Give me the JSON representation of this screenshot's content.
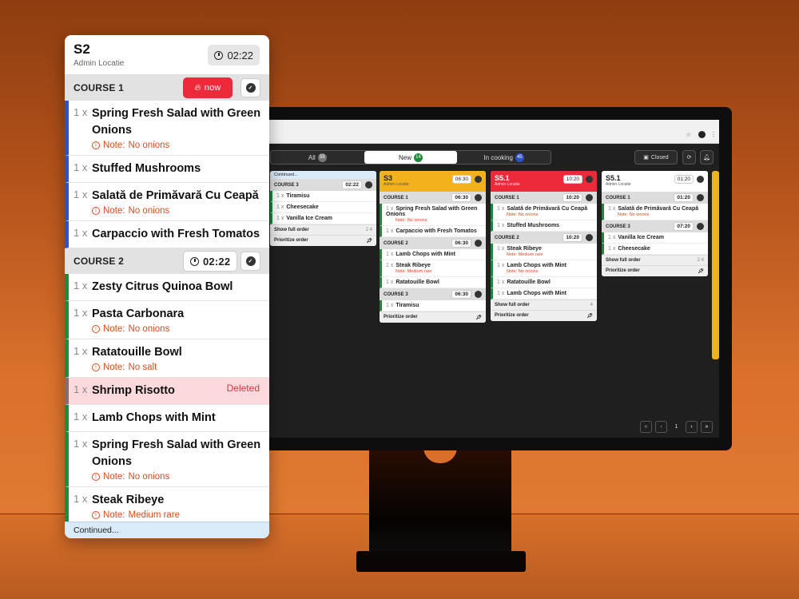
{
  "background_colors": {
    "accent_red": "#ec2a3a",
    "green": "#1d8b3b",
    "blue": "#2d53c8",
    "note_orange": "#e2481b"
  },
  "order": {
    "table": "S2",
    "location": "Admin Locatie",
    "timer": "02:22",
    "courses": [
      {
        "label": "COURSE 1",
        "action": "now",
        "items": [
          {
            "qty": "1 x",
            "name": "Spring Fresh Salad with Green Onions",
            "note_label": "Note:",
            "note": "No onions"
          },
          {
            "qty": "1 x",
            "name": "Stuffed Mushrooms"
          },
          {
            "qty": "1 x",
            "name": "Salată de Primăvară Cu Ceapă",
            "note_label": "Note:",
            "note": "No onions"
          },
          {
            "qty": "1 x",
            "name": "Carpaccio with Fresh Tomatos"
          }
        ]
      },
      {
        "label": "COURSE 2",
        "timer": "02:22",
        "items": [
          {
            "qty": "1 x",
            "name": "Zesty Citrus Quinoa Bowl"
          },
          {
            "qty": "1 x",
            "name": "Pasta Carbonara",
            "note_label": "Note:",
            "note": "No onions"
          },
          {
            "qty": "1 x",
            "name": "Ratatouille Bowl",
            "note_label": "Note:",
            "note": "No salt"
          },
          {
            "qty": "1 x",
            "name": "Shrimp Risotto",
            "status": "Deleted"
          },
          {
            "qty": "1 x",
            "name": "Lamb Chops with Mint"
          },
          {
            "qty": "1 x",
            "name": "Spring Fresh Salad with Green Onions",
            "note_label": "Note:",
            "note": "No onions"
          },
          {
            "qty": "1 x",
            "name": "Steak Ribeye",
            "note_label": "Note:",
            "note": "Medium rare"
          }
        ]
      }
    ],
    "continued": "Continued..."
  },
  "monitor": {
    "filters": [
      {
        "label": "All",
        "count": "59"
      },
      {
        "label": "New",
        "count": "14"
      },
      {
        "label": "In cooking",
        "count": "45"
      }
    ],
    "closed_label": "Closed",
    "cards": [
      {
        "header": "Continued...",
        "course": "COURSE 3",
        "time": "02:22",
        "items": [
          "Tiramisu",
          "Cheesecake",
          "Vanilla Ice Cream"
        ],
        "foot": "Show full order",
        "foot_counts": "2   4",
        "prio": "Prioritize order"
      },
      {
        "title": "S3",
        "sub": "Admin Locatie",
        "time": "06:30",
        "course1": "COURSE 1",
        "c1time": "06:30",
        "items1": [
          "Spring Fresh Salad with Green Onions",
          "Carpaccio with Fresh Tomatos"
        ],
        "note1": "No onions",
        "course2": "COURSE 2",
        "c2time": "06:30",
        "items2": [
          "Lamb Chops with Mint",
          "Steak Ribeye",
          "Ratatouille Bowl"
        ],
        "note2": "Medium rare",
        "course3": "COURSE 3",
        "c3time": "06:30",
        "items3": [
          "Tiramisu"
        ],
        "prio": "Prioritize order"
      },
      {
        "title": "S5.1",
        "sub": "Admin Locatie",
        "time": "10:20",
        "course1": "COURSE 1",
        "c1time": "10:20",
        "items1": [
          "Salată de Primăvară Cu Ceapă",
          "Stuffed Mushrooms"
        ],
        "note1": "No onions",
        "course2": "COURSE 2",
        "c2time": "10:20",
        "items2": [
          "Steak Ribeye",
          "Lamb Chops with Mint",
          "Ratatouille Bowl",
          "Lamb Chops with Mint"
        ],
        "note2a": "Medium rare",
        "note2b": "No onions",
        "foot": "Show full order",
        "foot_counts": "4",
        "prio": "Prioritize order"
      },
      {
        "title": "S5.1",
        "sub": "Admin Locatie",
        "time": "01:20",
        "course1": "COURSE 1",
        "c1time": "01:20",
        "items1": [
          "Salată de Primăvară Cu Ceapă"
        ],
        "note1": "No onions",
        "course3": "COURSE 3",
        "c3time": "07:20",
        "items3": [
          "Vanilla Ice Cream",
          "Cheesecake"
        ],
        "foot": "Show full order",
        "foot_counts": "2   4",
        "prio": "Prioritize order"
      }
    ],
    "page": "1",
    "qty": "1 x",
    "note_label": "Note:"
  }
}
